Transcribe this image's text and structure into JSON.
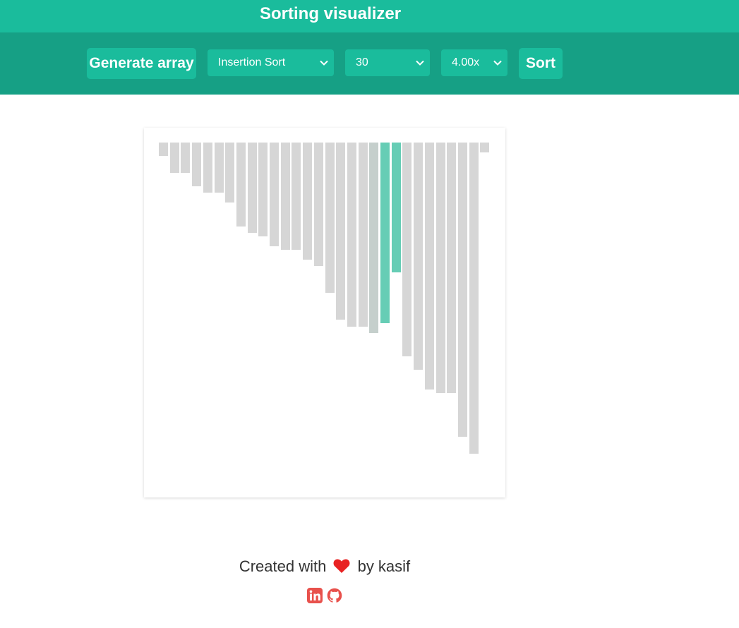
{
  "header": {
    "title": "Sorting visualizer"
  },
  "toolbar": {
    "generate_label": "Generate array",
    "algorithm_selected": "Insertion Sort",
    "size_selected": "30",
    "speed_selected": "4.00x",
    "sort_label": "Sort"
  },
  "visualizer": {
    "array_values": [
      19,
      43,
      43,
      62,
      71,
      71,
      85,
      119,
      128,
      133,
      147,
      152,
      152,
      166,
      175,
      213,
      251,
      261,
      261,
      270,
      256,
      184,
      303,
      322,
      350,
      355,
      355,
      417,
      441,
      14
    ],
    "active_indices": [
      20,
      21
    ],
    "pending_indices": [
      19
    ],
    "colors": {
      "bar": "#d6d6d6",
      "active": "#66cdb5",
      "pending": "#c5cfcc"
    }
  },
  "footer": {
    "prefix": "Created with",
    "suffix": "by kasif",
    "heart_color": "#e82222",
    "icons": [
      "linkedin-icon",
      "github-icon"
    ],
    "icon_color": "#e8514c"
  },
  "theme": {
    "primary": "#1abc9c",
    "primary_dark": "#16a085"
  }
}
